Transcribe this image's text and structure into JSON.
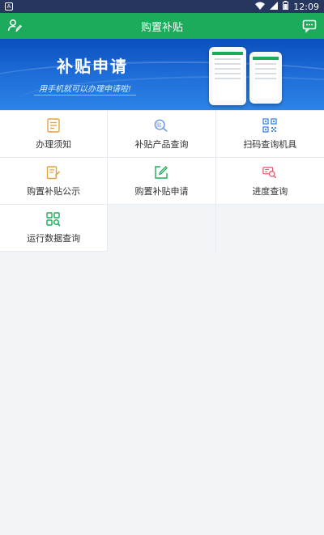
{
  "status": {
    "time": "12:09",
    "left_badge": "A"
  },
  "header": {
    "title": "购置补贴"
  },
  "banner": {
    "title": "补贴申请",
    "subtitle": "用手机就可以办理申请啦!"
  },
  "menu": [
    {
      "label": "办理须知",
      "icon": "document-icon"
    },
    {
      "label": "补贴产品查询",
      "icon": "search-subsidy-icon"
    },
    {
      "label": "扫码查询机具",
      "icon": "qr-code-icon"
    },
    {
      "label": "购置补贴公示",
      "icon": "notice-edit-icon"
    },
    {
      "label": "购置补贴申请",
      "icon": "edit-box-icon"
    },
    {
      "label": "进度查询",
      "icon": "progress-search-icon"
    },
    {
      "label": "运行数据查询",
      "icon": "grid-search-icon"
    }
  ],
  "colors": {
    "primary": "#1bab5b",
    "status_bar": "#27365f",
    "banner_blue": "#1e6dd8"
  }
}
